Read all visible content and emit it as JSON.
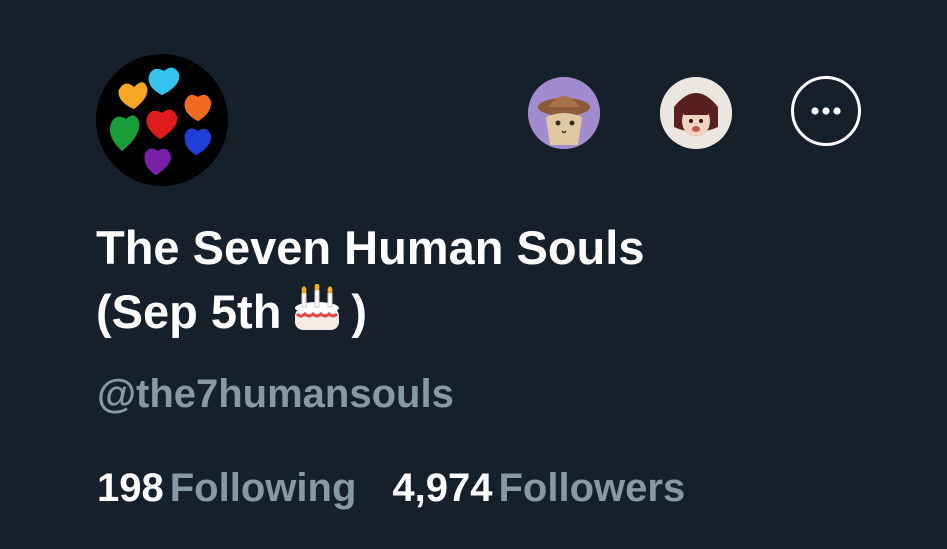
{
  "profile": {
    "display_name": "The Seven Human Souls",
    "display_name_suffix_open": "(Sep 5th",
    "display_name_suffix_close": ")",
    "birthday_icon": "birthday-cake-icon",
    "handle": "@the7humansouls",
    "avatar_icon": "seven-colored-hearts-icon"
  },
  "header_actions": {
    "followed_by_avatars": [
      "cat-hat-character-avatar",
      "dark-haired-character-avatar"
    ],
    "more_icon": "ellipsis-icon"
  },
  "stats": {
    "following_count": "198",
    "following_label": "Following",
    "followers_count": "4,974",
    "followers_label": "Followers"
  },
  "colors": {
    "background": "#15202b",
    "primary_text": "#ffffff",
    "secondary_text": "#8899a6"
  }
}
